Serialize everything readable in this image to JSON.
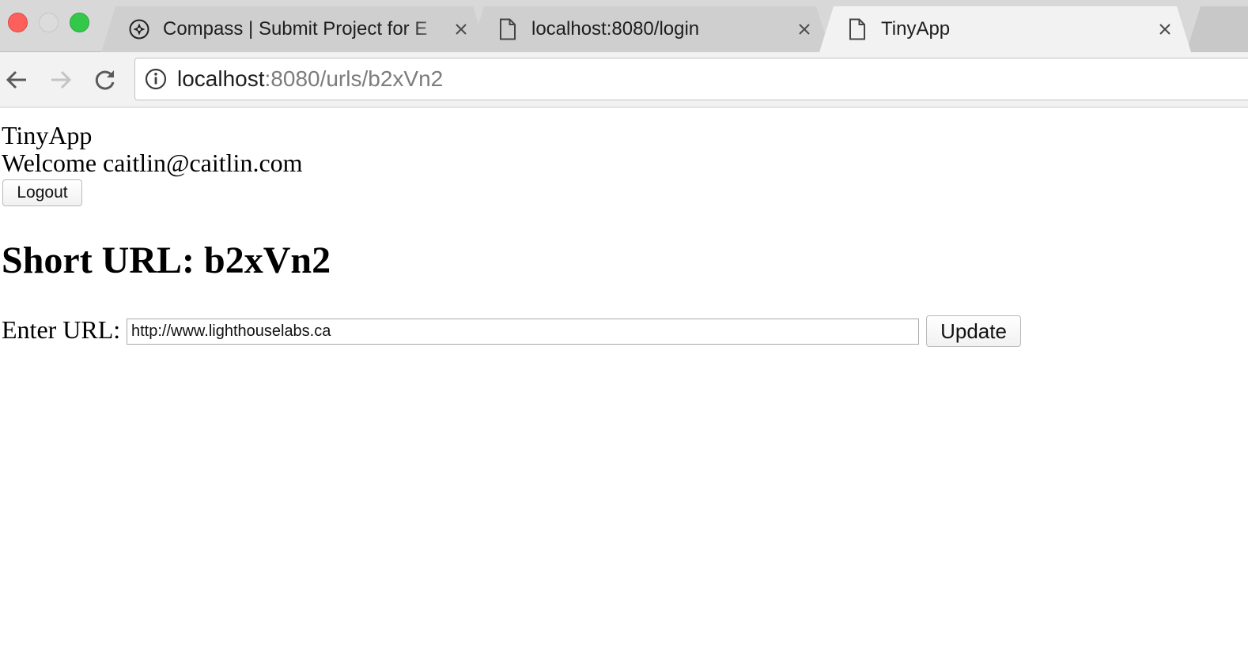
{
  "browser": {
    "tabs": [
      {
        "title": "Compass | Submit Project for E",
        "icon": "compass-icon",
        "active": false
      },
      {
        "title": "localhost:8080/login",
        "icon": "document-icon",
        "active": false
      },
      {
        "title": "TinyApp",
        "icon": "document-icon",
        "active": true
      }
    ],
    "address": {
      "host": "localhost",
      "rest": ":8080/urls/b2xVn2"
    },
    "colors": {
      "close": "#fc605c",
      "minimize": "#dcdcdc",
      "maximize": "#34c84a",
      "tabstrip": "#d8d8d8",
      "active_tab": "#f2f2f2"
    }
  },
  "page": {
    "brand": "TinyApp",
    "welcome": "Welcome caitlin@caitlin.com",
    "logout_label": "Logout",
    "heading": "Short URL: b2xVn2",
    "form": {
      "label": "Enter URL:",
      "value": "http://www.lighthouselabs.ca",
      "submit_label": "Update"
    }
  }
}
